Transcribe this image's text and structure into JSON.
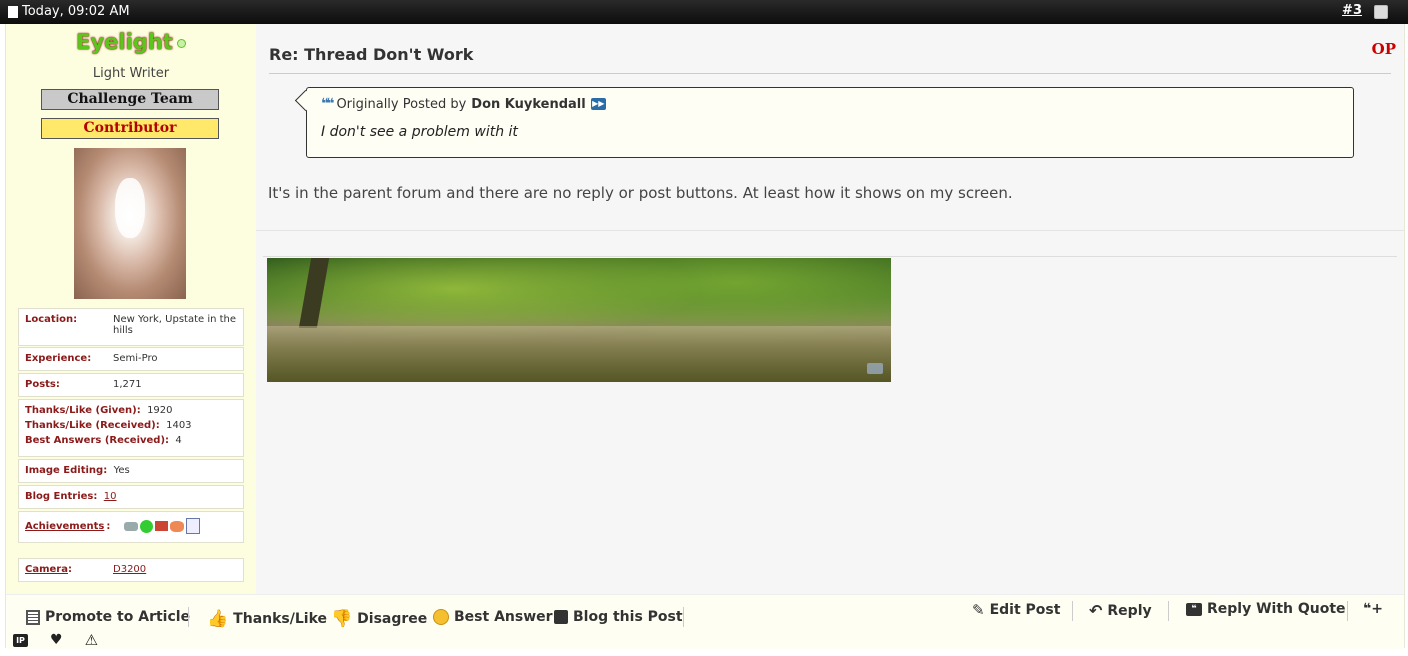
{
  "header": {
    "date": "Today, 09:02 AM",
    "post_number": "#3"
  },
  "user": {
    "name": "Eyelight",
    "title": "Light Writer",
    "badges": [
      "Challenge Team",
      "Contributor"
    ],
    "info": {
      "location_label": "Location:",
      "location": "New York, Upstate in the hills",
      "experience_label": "Experience:",
      "experience": "Semi-Pro",
      "posts_label": "Posts:",
      "posts": "1,271",
      "thanks_given_label": "Thanks/Like (Given):",
      "thanks_given": "1920",
      "thanks_received_label": "Thanks/Like (Received):",
      "thanks_received": "1403",
      "best_answers_label": "Best Answers (Received):",
      "best_answers": "4",
      "image_editing_label": "Image Editing:",
      "image_editing": "Yes",
      "blog_entries_label": "Blog Entries:",
      "blog_entries": "10",
      "achievements_label": "Achievements",
      "camera_label": "Camera",
      "camera": "D3200"
    }
  },
  "post": {
    "title": "Re: Thread Don't Work",
    "op_label": "OP",
    "quote": {
      "prefix": "Originally Posted by",
      "author": "Don Kuykendall",
      "text": "I don't see a problem with it"
    },
    "message": "It's in the parent forum and there are no reply or post buttons. At least how it shows on my screen."
  },
  "footer": {
    "promote": "Promote to Article",
    "thanks": "Thanks/Like",
    "disagree": "Disagree",
    "best_answer": "Best Answer",
    "blog_post": "Blog this Post",
    "edit_post": "Edit Post",
    "reply": "Reply",
    "reply_quote": "Reply With Quote"
  },
  "colors": {
    "op_red": "#cc0000",
    "label_red": "#8b1a1a",
    "username_green": "#5cc61e"
  }
}
